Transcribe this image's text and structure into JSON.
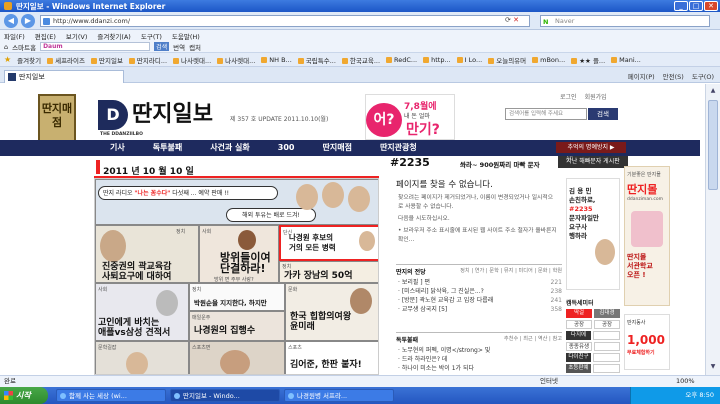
{
  "window": {
    "title": "딴지일보 - Windows Internet Explorer",
    "minimize": "_",
    "maximize": "□",
    "close": "✕"
  },
  "address": {
    "back": "◀",
    "forward": "▶",
    "url": "http://www.ddanzi.com/",
    "refresh": "⟳",
    "stop": "✕",
    "search_label": "Naver",
    "search_placeholder": "Naver"
  },
  "menu": [
    "파일(F)",
    "편집(E)",
    "보기(V)",
    "즐겨찾기(A)",
    "도구(T)",
    "도움말(H)"
  ],
  "toolbar": {
    "smart": "스마트홈",
    "daum_box": "Daum",
    "go": "검색",
    "translate": "번역",
    "capture": "캡처"
  },
  "favorites": {
    "label": "즐겨찾기",
    "items": [
      "세프라이즈",
      "딴지일보",
      "딴지라디...",
      "나사렛대...",
      "나사렛대...",
      "NH B...",
      "국립특수...",
      "한국교육...",
      "RedC...",
      "http...",
      "I Lo...",
      "오늘의유머",
      "mBon...",
      "★★ 플...",
      "Mani..."
    ]
  },
  "tab": {
    "label": "딴지일보",
    "tools": [
      "페이지(P)",
      "안전(S)",
      "도구(O)"
    ]
  },
  "site": {
    "logo_box": "딴지매점",
    "logo_mark": "D",
    "brand": "딴지일보",
    "brand_sub": "THE DDANZIILBO",
    "issue": "제 357 호 UPDATE 2011.10.10(월)",
    "ad_o": "어?",
    "ad_t1": "7,8월에",
    "ad_t2": "내 돈 얼마",
    "ad_t3": "만기?",
    "top_links": [
      "로그인",
      "회원가입"
    ],
    "search_placeholder": "검색어를 입력해 주세요",
    "search_button": "검색",
    "nav": [
      "기사",
      "독투불패",
      "사건과 실화",
      "300",
      "딴지매점",
      "딴지관광청"
    ],
    "hot_button": "추억의 명예방지 ▶"
  },
  "headline": {
    "date": "2011 년 10 월 10 일",
    "hashtag": "#2235",
    "hash_title": "쏴라~ 900원짜리 마빡 문자",
    "hash_button": "지난 해빠문자 게시판"
  },
  "cover": {
    "bubble1_pre": "딴지 라디오 ",
    "bubble1_em": "\"나는 꼼수다\"",
    "bubble1_post": " 다섯째 ... 예약 판매 !!",
    "bubble2": "해외 투유는 배로 드겨!",
    "p1": "진중권의 곽교육감\n사퇴요구에 대하여",
    "p1_cat": "정치",
    "p2": "방위들이여\n단결하라!",
    "p2_sub": "방위 면 주부 사랑?",
    "p2_cat": "사회",
    "p3_label": "단신",
    "p3": "나경원 후보의\n거의 모든 병력",
    "p4": "가카 장남의 50억",
    "p4_cat": "정치",
    "p5": "고인에게 바치는\n애플vs삼성 견적서",
    "p5_cat": "사회",
    "p6": "박원순을 지지한다, 하지만",
    "p6_cat": "정치",
    "p7": "한국 힙합의여왕\n윤미래",
    "p7_cat": "문화",
    "p8": "나경원의 집행수",
    "p8_cat": "매일운주",
    "p9_cat": "문학길잡",
    "p10_cat": "스포츠면",
    "p11_cat": "스포츠",
    "p11": "김어준, 한판 붙자!"
  },
  "notfound": {
    "title": "페이지를 찾을 수 없습니다.",
    "body": [
      "찾으려는 페이지가 제거되었거나, 이름이 변경되었거나 일시적으로 사용할 수 없습니다.",
      "다음을 시도하십시오.",
      "• 브라우저 주소 표시줄에 표시된 웹 사이트 주소 철자가 올바른지 확인..."
    ]
  },
  "jinsim": {
    "title": "딴지의 전당",
    "tabs": "정치 | 연가 | 문학 | 뮤지 | 미디어 | 문화 | 학원",
    "items": [
      {
        "t": "· 보리필 ] 편",
        "n": "221"
      },
      {
        "t": "· [미스테리] 닭삭육, 그 진실은...?",
        "n": "238"
      },
      {
        "t": "· [방문] 곽노현 교육감 고 입장 다룹래",
        "n": "241"
      },
      {
        "t": "· 교무생 삼국지 [5]",
        "n": "358"
      }
    ]
  },
  "dokpae": {
    "title": "독투불패",
    "tabs": "추천수 | 최근 | 역산 | 참고",
    "items": [
      {
        "t": "· 노무현의 퍼펙, 이명</strong> 및",
        "n": ""
      },
      {
        "t": "· 드라 하라인은? 데",
        "n": ""
      },
      {
        "t": "· 하나이 미소는 박이 1가 되다",
        "n": ""
      }
    ]
  },
  "sidebar": {
    "ad_label": "AD",
    "box_pre": "김 용 민",
    "box_l1": "손친하로,",
    "box_l2": "문자파일만",
    "box_l3": "요구사",
    "box_l4": "행하라",
    "box_red": "#2235",
    "menu_title": "캠득세미터",
    "rows": [
      [
        "딱걸",
        "김대경"
      ],
      [
        "공장",
        "공장"
      ],
      [
        "다지에",
        ""
      ],
      [
        "종종유생",
        ""
      ],
      [
        "다이친구",
        ""
      ],
      [
        "초등판예",
        ""
      ]
    ]
  },
  "rightad": {
    "head": "기분좋은 딴지몰",
    "big": "딴지몰",
    "site": "ddanziman.com",
    "t": "딴지몰\n서관학교\n오픈 !",
    "t2": "딴지동사",
    "b": "1,000",
    "s": "무료체험하기"
  },
  "status": {
    "text": "완료",
    "zone": "인터넷",
    "zoom": "100%"
  },
  "taskbar": {
    "start": "시작",
    "tasks": [
      "함께 사는 세상 (wi...",
      "딴지일보 - Windo...",
      "나경원병 서프라..."
    ],
    "clock": "오후 8:50"
  }
}
